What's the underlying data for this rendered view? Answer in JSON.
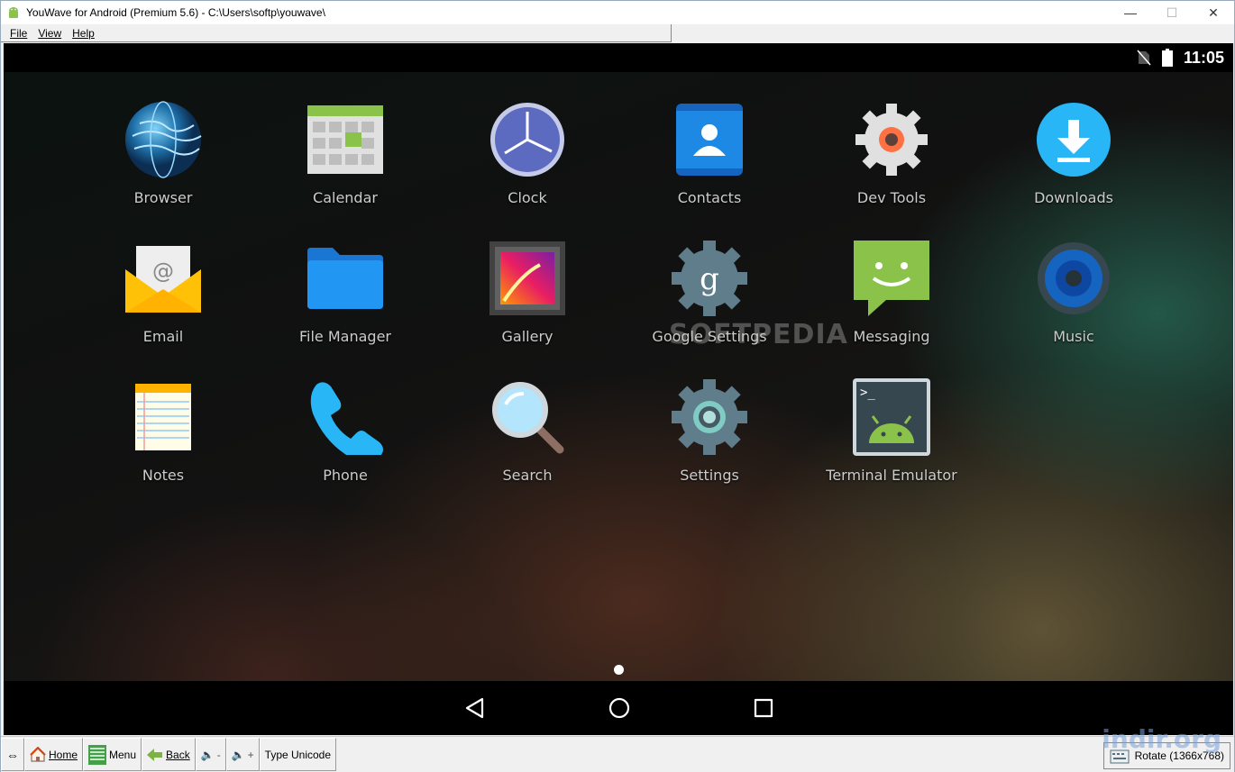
{
  "window": {
    "title": "YouWave for Android (Premium 5.6) - C:\\Users\\softp\\youwave\\",
    "controls": {
      "minimize": "—",
      "maximize": "☐",
      "close": "✕"
    }
  },
  "menu": {
    "items": [
      "File",
      "View",
      "Help"
    ]
  },
  "statusbar": {
    "time": "11:05"
  },
  "apps": [
    {
      "label": "Browser",
      "icon": "globe-icon"
    },
    {
      "label": "Calendar",
      "icon": "calendar-icon"
    },
    {
      "label": "Clock",
      "icon": "clock-icon"
    },
    {
      "label": "Contacts",
      "icon": "contacts-icon"
    },
    {
      "label": "Dev Tools",
      "icon": "gear-icon"
    },
    {
      "label": "Downloads",
      "icon": "download-icon"
    },
    {
      "label": "Email",
      "icon": "envelope-icon"
    },
    {
      "label": "File Manager",
      "icon": "folder-icon"
    },
    {
      "label": "Gallery",
      "icon": "picture-icon"
    },
    {
      "label": "Google Settings",
      "icon": "google-gear-icon"
    },
    {
      "label": "Messaging",
      "icon": "chat-bubble-icon"
    },
    {
      "label": "Music",
      "icon": "speaker-icon"
    },
    {
      "label": "Notes",
      "icon": "notepad-icon"
    },
    {
      "label": "Phone",
      "icon": "phone-icon"
    },
    {
      "label": "Search",
      "icon": "magnifier-icon"
    },
    {
      "label": "Settings",
      "icon": "settings-gear-icon"
    },
    {
      "label": "Terminal Emulator",
      "icon": "terminal-android-icon"
    }
  ],
  "watermark": "SOFTPEDIA",
  "toolbar": {
    "home": "Home",
    "menu": "Menu",
    "back": "Back",
    "vol_down": "-",
    "vol_up": "+",
    "type_unicode": "Type Unicode",
    "rotate": "Rotate (1366x768)",
    "brand": "indir.org"
  }
}
